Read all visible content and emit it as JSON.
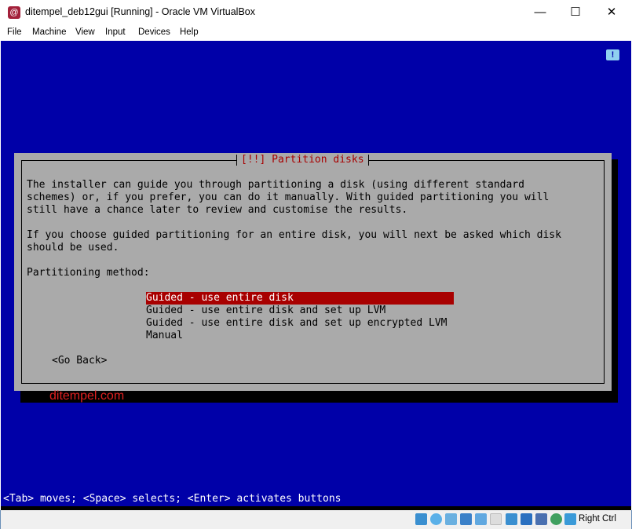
{
  "window": {
    "title": "ditempel_deb12gui [Running] - Oracle VM VirtualBox",
    "controls": [
      "minimize",
      "maximize",
      "close"
    ]
  },
  "menu": [
    "File",
    "Machine",
    "View",
    "Input",
    "Devices",
    "Help"
  ],
  "dialog": {
    "title": "[!!] Partition disks",
    "paragraphs": [
      "The installer can guide you through partitioning a disk (using different standard",
      "schemes) or, if you prefer, you can do it manually. With guided partitioning you will",
      "still have a chance later to review and customise the results.",
      "If you choose guided partitioning for an entire disk, you will next be asked which disk",
      "should be used."
    ],
    "prompt": "Partitioning method:",
    "options": [
      "Guided - use entire disk",
      "Guided - use entire disk and set up LVM",
      "Guided - use entire disk and set up encrypted LVM",
      "Manual"
    ],
    "selected_index": 0,
    "go_back": "<Go Back>"
  },
  "watermark": "ditempel.com",
  "help_line": "<Tab> moves; <Space> selects; <Enter> activates buttons",
  "statusbar": {
    "icons": [
      "hard-disk-icon",
      "optical-disk-icon",
      "audio-icon",
      "network-icon",
      "usb-icon",
      "shared-folders-icon",
      "display-icon",
      "video-capture-icon",
      "virtualization-icon",
      "mouse-integration-icon",
      "keyboard-icon"
    ],
    "host_key": "Right Ctrl"
  },
  "colors": {
    "screen": "#0000a8",
    "dialog": "#aaaaaa",
    "selection": "#a80000",
    "title": "#a80000"
  }
}
